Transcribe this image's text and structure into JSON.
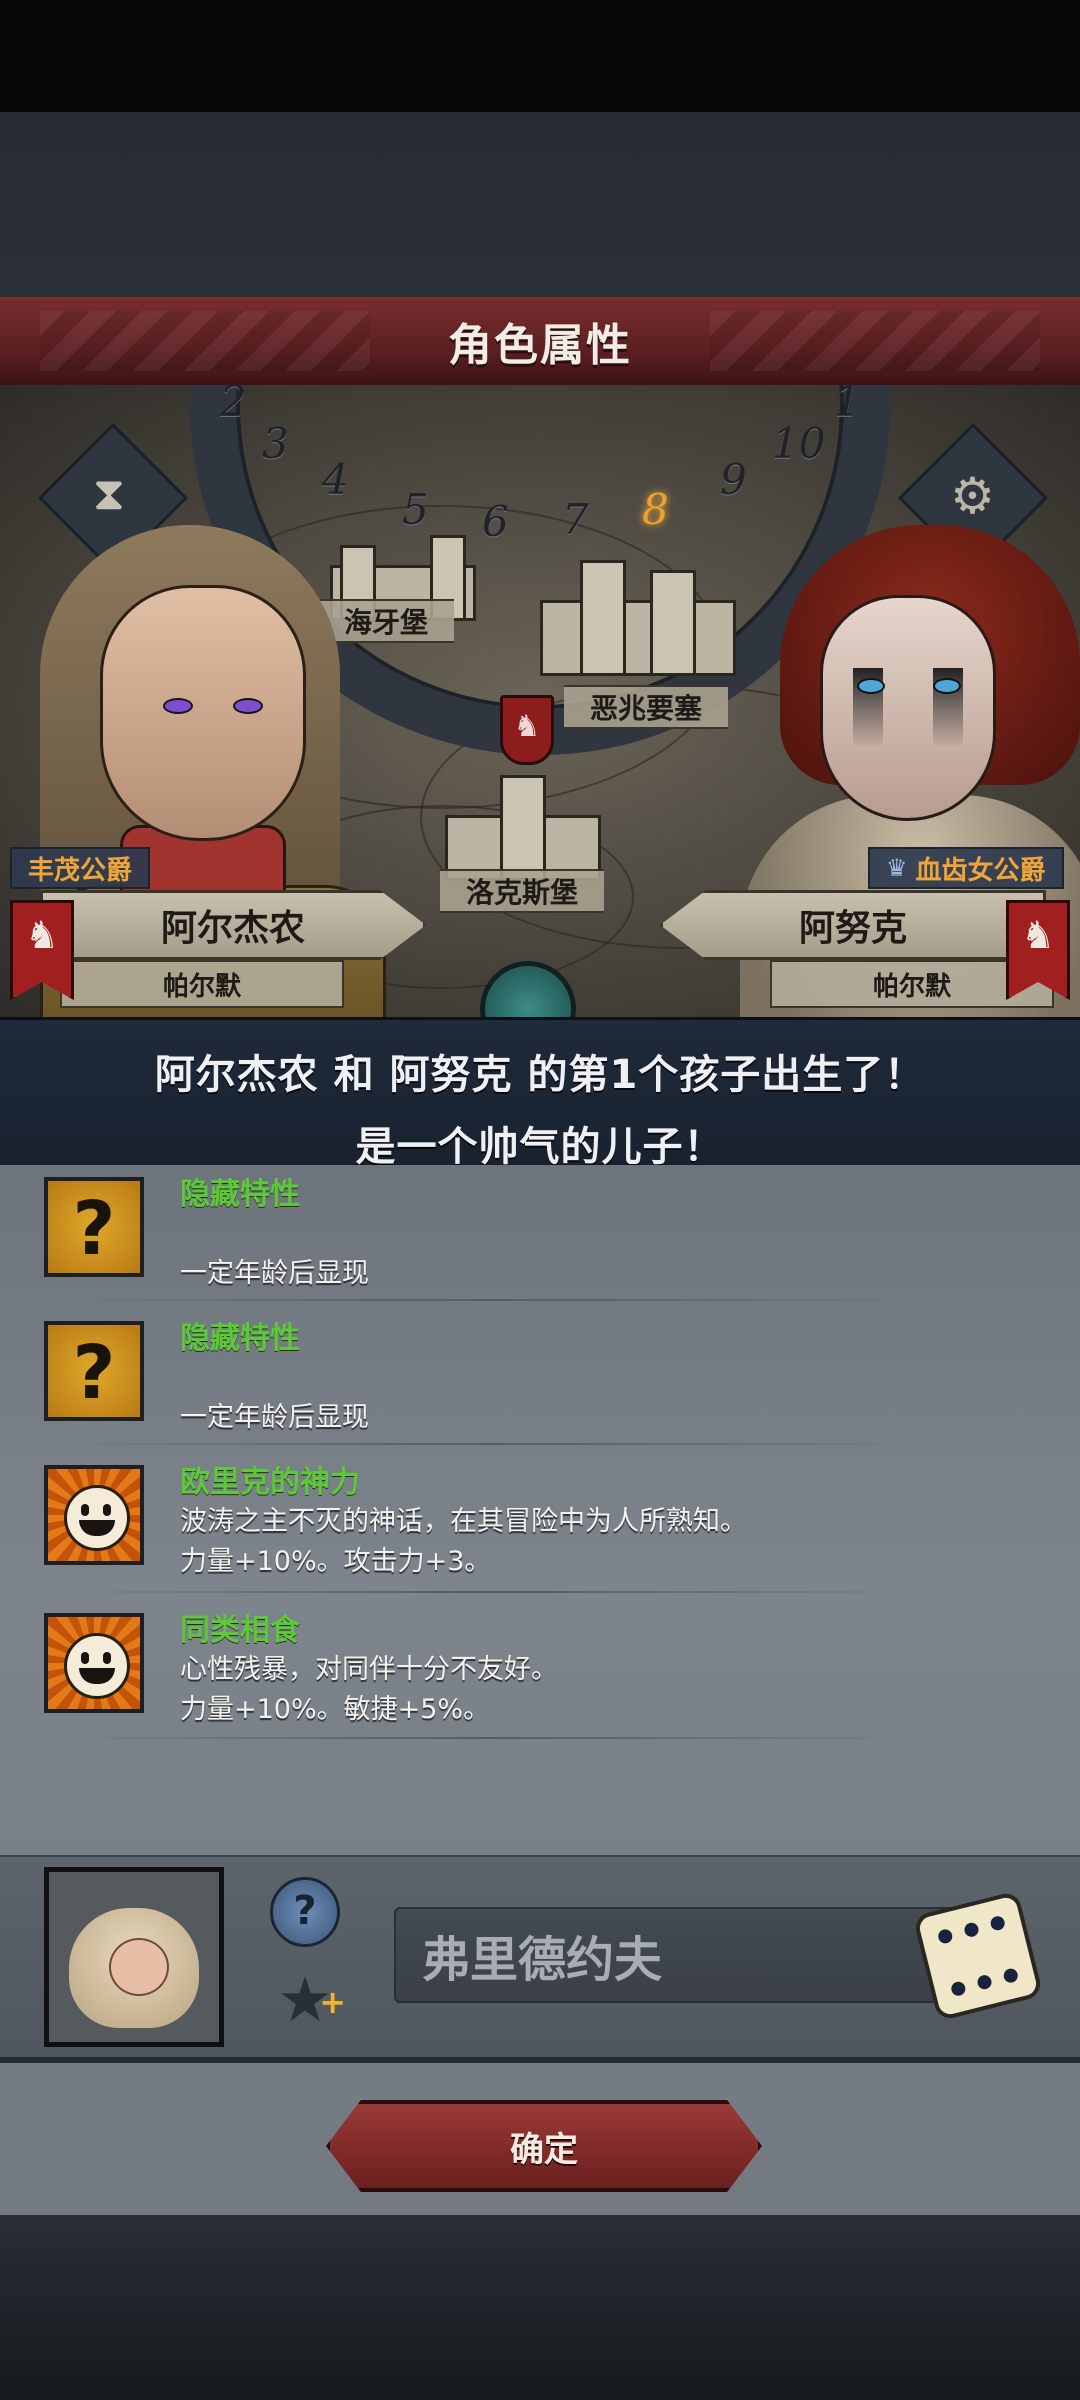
{
  "header": {
    "title": "角色属性"
  },
  "map": {
    "dial_numbers": [
      "2",
      "3",
      "4",
      "5",
      "6",
      "7",
      "8",
      "9",
      "10",
      "1"
    ],
    "active_day": "8",
    "places": [
      "海牙堡",
      "恶兆要塞",
      "洛克斯堡"
    ]
  },
  "parents": {
    "left": {
      "rank": "丰茂公爵",
      "name": "阿尔杰农",
      "house": "帕尔默"
    },
    "right": {
      "rank": "血齿女公爵",
      "name": "阿努克",
      "house": "帕尔默"
    }
  },
  "announcement": {
    "line1": "阿尔杰农 和 阿努克 的第1个孩子出生了！",
    "line2": "是一个帅气的儿子！"
  },
  "traits": [
    {
      "name": "隐藏特性",
      "icon": "question-icon",
      "desc1": "一定年龄后显现",
      "desc2": ""
    },
    {
      "name": "隐藏特性",
      "icon": "question-icon",
      "desc1": "一定年龄后显现",
      "desc2": ""
    },
    {
      "name": "欧里克的神力",
      "icon": "smile-sun-icon",
      "desc1": "波涛之主不灭的神话，在其冒险中为人所熟知。",
      "desc2": "力量+10%。攻击力+3。"
    },
    {
      "name": "同类相食",
      "icon": "smile-sun-icon",
      "desc1": "心性残暴，对同伴十分不友好。",
      "desc2": "力量+10%。敏捷+5%。"
    }
  ],
  "child": {
    "name_value": "弗里德约夫",
    "help_symbol": "?",
    "star_symbol": "★",
    "star_plus": "+"
  },
  "icons": {
    "hourglass": "⧗",
    "gear": "⚙",
    "wolf": "♞",
    "crown": "♛",
    "question": "?"
  },
  "confirm_label": "确定",
  "colors": {
    "accent_red": "#7a2e2e",
    "trait_green": "#5ec83a",
    "rank_orange": "#f0a53a"
  }
}
